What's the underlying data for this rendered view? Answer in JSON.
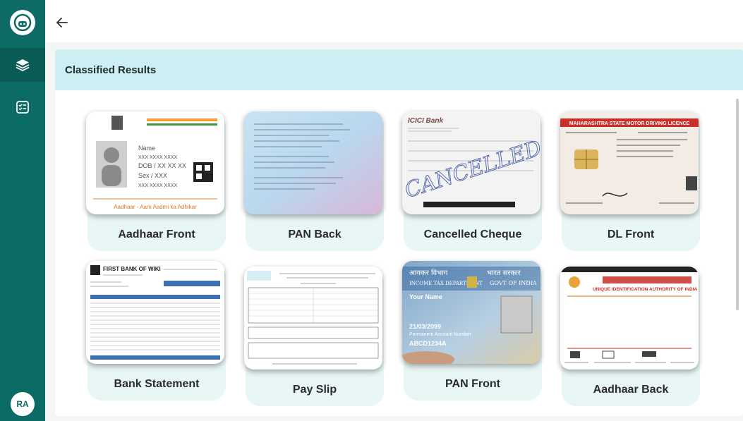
{
  "sidebar": {
    "avatar_initials": "RA",
    "items": [
      {
        "icon": "layers-icon",
        "active": true
      },
      {
        "icon": "checklist-icon",
        "active": false
      }
    ]
  },
  "header": {
    "title": "Classified Results"
  },
  "cards": [
    {
      "label": "Aadhaar Front",
      "caption": "Aadhaar - Aam Aadmi ka Adhikar",
      "fields": [
        "Name",
        "XXX XXXX XXXX",
        "DOB / XX XX XX",
        "Sex / XXX",
        "XXX XXXX XXXX"
      ]
    },
    {
      "label": "PAN Back"
    },
    {
      "label": "Cancelled Cheque",
      "bank": "ICICI Bank",
      "stamp": "CANCELLED"
    },
    {
      "label": "DL Front",
      "heading": "MAHARASHTRA STATE MOTOR DRIVING LICENCE"
    },
    {
      "label": "Bank Statement",
      "bank": "FIRST BANK OF WIKI"
    },
    {
      "label": "Pay Slip"
    },
    {
      "label": "PAN Front",
      "left_text": "आयकर विभाग",
      "right_text": "भारत सरकार",
      "dept": "INCOME TAX DEPARTMENT",
      "govt": "GOVT OF INDIA",
      "name": "Your Name",
      "date": "21/03/2099",
      "pan_label": "Permanent Account Number",
      "pan": "ABCD1234A"
    },
    {
      "label": "Aadhaar Back",
      "authority": "UNIQUE IDENTIFICATION AUTHORITY OF INDIA"
    }
  ],
  "colors": {
    "sidebar": "#0d6b66",
    "header_strip": "#cdeef2",
    "card_bg": "#e8f6f6"
  }
}
